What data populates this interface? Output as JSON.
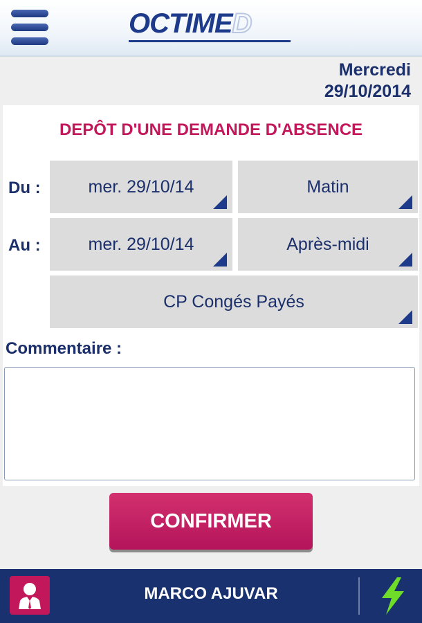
{
  "app": {
    "logo_text": "OCTIME",
    "date_line1": "Mercredi",
    "date_line2": "29/10/2014"
  },
  "form": {
    "title": "DEPÔT D'UNE DEMANDE D'ABSENCE",
    "from_label": "Du :",
    "from_date": "mer. 29/10/14",
    "from_period": "Matin",
    "to_label": "Au :",
    "to_date": "mer. 29/10/14",
    "to_period": "Après-midi",
    "absence_type": "CP Congés Payés",
    "comment_label": "Commentaire :",
    "comment_value": "",
    "confirm_label": "CONFIRMER"
  },
  "footer": {
    "user_name": "MARCO AJUVAR"
  },
  "icons": {
    "menu": "hamburger-menu-icon",
    "user": "user-profile-icon",
    "bolt": "lightning-bolt-icon",
    "dropdown": "dropdown-triangle-icon"
  },
  "colors": {
    "brand_blue": "#1e3a8a",
    "accent_pink": "#c2185b",
    "bolt_green": "#6fdc2a"
  }
}
